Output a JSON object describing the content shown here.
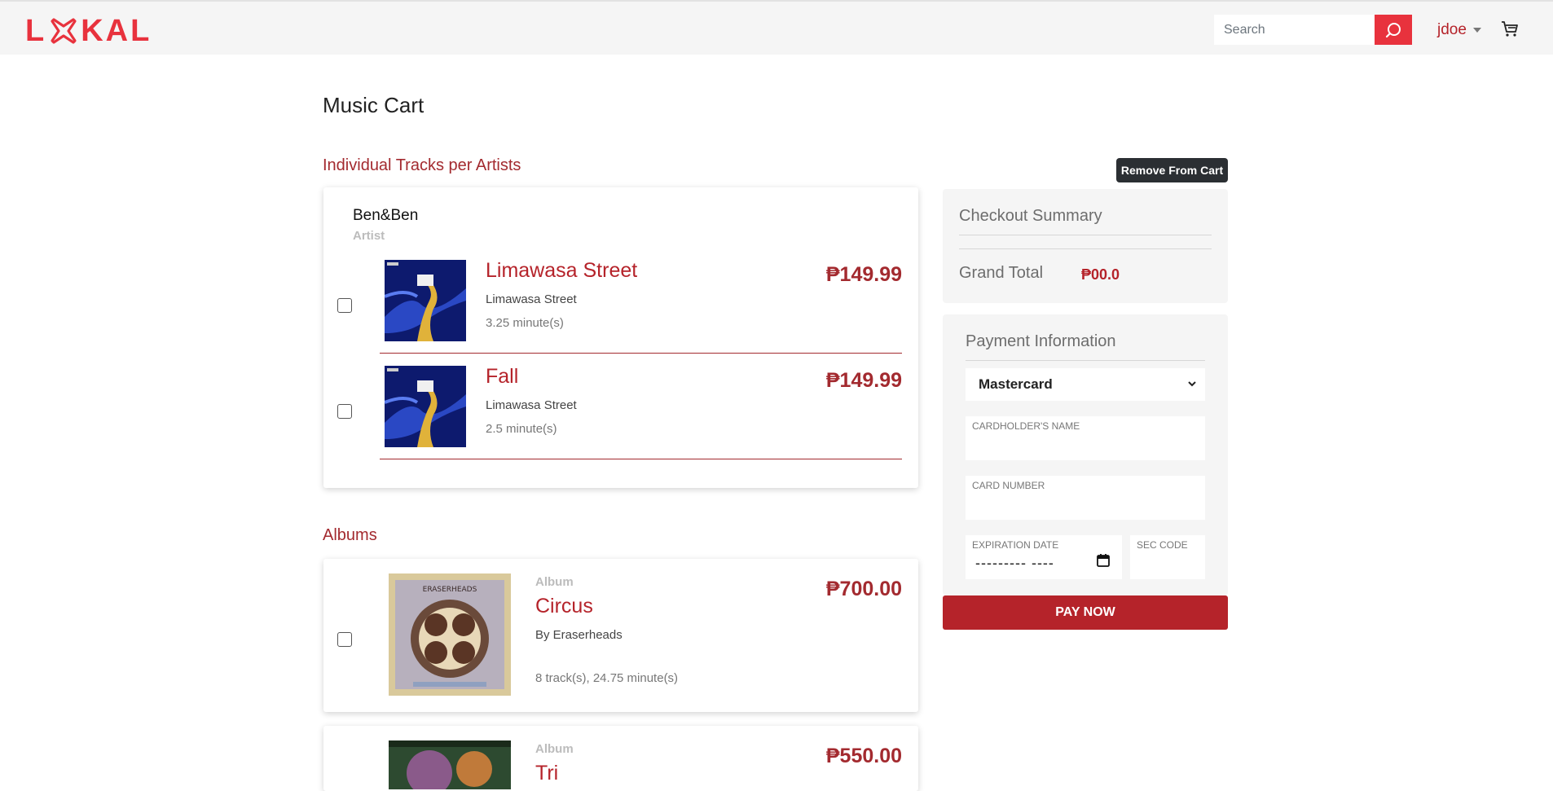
{
  "header": {
    "logo_text": "LOKAL",
    "logo_left": "L",
    "logo_right": "KAL",
    "search_placeholder": "Search",
    "username": "jdoe"
  },
  "main": {
    "title": "Music Cart",
    "tracks_section": "Individual Tracks per Artists",
    "artist": {
      "name": "Ben&Ben",
      "label": "Artist"
    },
    "tracks": [
      {
        "title": "Limawasa Street",
        "album": "Limawasa Street",
        "duration": "3.25 minute(s)",
        "price": "₱149.99"
      },
      {
        "title": "Fall",
        "album": "Limawasa Street",
        "duration": "2.5 minute(s)",
        "price": "₱149.99"
      }
    ],
    "albums_section": "Albums",
    "albums": [
      {
        "label": "Album",
        "title": "Circus",
        "artist": "By Eraserheads",
        "meta": "8 track(s), 24.75 minute(s)",
        "price": "₱700.00",
        "cover_text": "ERASERHEADS"
      },
      {
        "label": "Album",
        "title": "Tri",
        "price": "₱550.00"
      }
    ]
  },
  "tooltip": "Remove From Cart",
  "checkout": {
    "title": "Checkout Summary",
    "grand_total_label": "Grand Total",
    "grand_total_value": "₱00.0"
  },
  "payment": {
    "title": "Payment Information",
    "card_type": "Mastercard",
    "cardholder_label": "CARDHOLDER'S NAME",
    "card_number_label": "CARD NUMBER",
    "expiration_label": "EXPIRATION DATE",
    "expiration_value": "--------- ----",
    "sec_code_label": "SEC CODE",
    "pay_button": "PAY NOW"
  },
  "colors": {
    "accent": "#e8323d",
    "brand_dark": "#b5232a",
    "text": "#222222"
  }
}
